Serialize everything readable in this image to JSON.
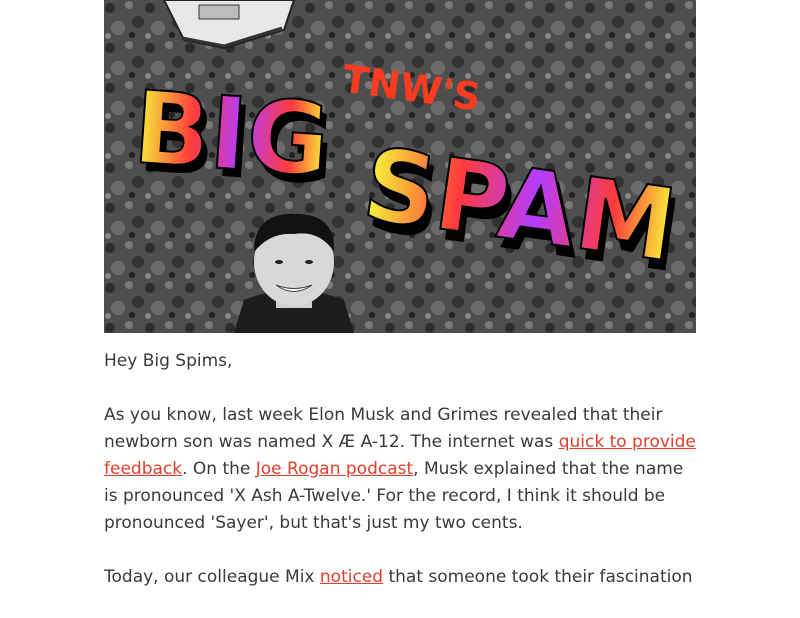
{
  "hero": {
    "kicker": "TNW'S",
    "title_line1": "BIG",
    "title_line2": "SPAM"
  },
  "greeting": "Hey Big Spims,",
  "paragraph1": {
    "part1": "As you know, last week Elon Musk and Grimes revealed that their newborn son was named X Æ A-12. The internet was ",
    "link1": "quick to provide feedback",
    "part2": ". On the ",
    "link2": "Joe Rogan podcast",
    "part3": ", Musk explained that the name is pronounced 'X Ash A-Twelve.' For the record, I think it should be pronounced 'Sayer', but that's just my two cents."
  },
  "paragraph2": {
    "part1": "Today, our colleague Mix ",
    "link1": "noticed",
    "part2": " that someone took their fascination"
  },
  "colors": {
    "link": "#e0402b",
    "text": "#3a3a3a",
    "title_fill": "#ff3b3b",
    "title_accent": "#f6ff3a",
    "title_purple": "#b43cff"
  }
}
